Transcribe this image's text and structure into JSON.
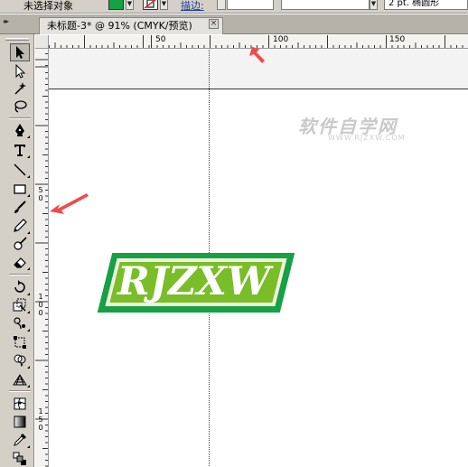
{
  "control_bar": {
    "selection_label": "未选择对象",
    "fill_color": "#16a144",
    "stroke_label": "描边:",
    "stroke_width_value": "",
    "brush_value": "2 pt. 椭圆形"
  },
  "document": {
    "tab_title": "未标题-3* @ 91% (CMYK/预览)",
    "close_glyph": "×"
  },
  "rulers": {
    "horizontal_labels": [
      "50",
      "100",
      "150"
    ],
    "vertical_labels": [
      "5\n0",
      "1\n0\n0",
      "1\n5\n0"
    ]
  },
  "artwork": {
    "logo_text": "RJZXW",
    "colors": {
      "outline": "#16a144",
      "inner": "#79bd28",
      "text": "#ffffff",
      "arrow": "#f04a48"
    }
  },
  "watermark": {
    "main": "软件自学网",
    "sub": "WWW.RJZXW.COM"
  },
  "tools": [
    "selection-tool",
    "direct-selection-tool",
    "magic-wand-tool",
    "lasso-tool",
    "pen-tool",
    "type-tool",
    "line-segment-tool",
    "rectangle-tool",
    "paintbrush-tool",
    "pencil-tool",
    "blob-brush-tool",
    "eraser-tool",
    "rotate-tool",
    "scale-tool",
    "warp-tool",
    "free-transform-tool",
    "shape-builder-tool",
    "perspective-grid-tool",
    "mesh-tool",
    "gradient-tool",
    "eyedropper-tool",
    "blend-tool"
  ]
}
